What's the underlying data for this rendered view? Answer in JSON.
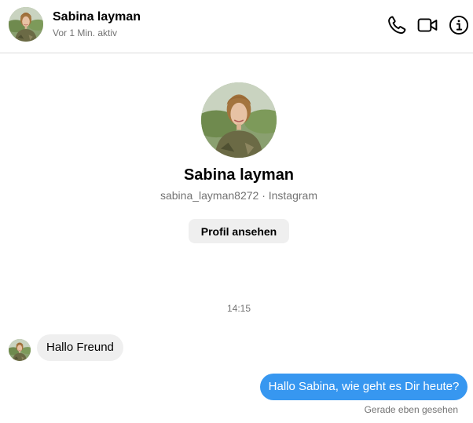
{
  "header": {
    "name": "Sabina layman",
    "status": "Vor 1 Min. aktiv",
    "icons": [
      "phone-icon",
      "video-camera-icon",
      "info-icon"
    ]
  },
  "profile": {
    "name": "Sabina layman",
    "subtitle": "sabina_layman8272 · Instagram",
    "button_label": "Profil ansehen"
  },
  "conversation": {
    "timestamp": "14:15",
    "messages": [
      {
        "direction": "incoming",
        "text": "Hallo Freund"
      },
      {
        "direction": "outgoing",
        "text": "Hallo Sabina, wie geht es Dir heute?"
      }
    ],
    "seen_status": "Gerade eben gesehen"
  },
  "colors": {
    "outgoing_bubble": "#3797f0",
    "incoming_bubble": "#efefef",
    "secondary_text": "#737373",
    "divider": "#dbdbdb"
  }
}
